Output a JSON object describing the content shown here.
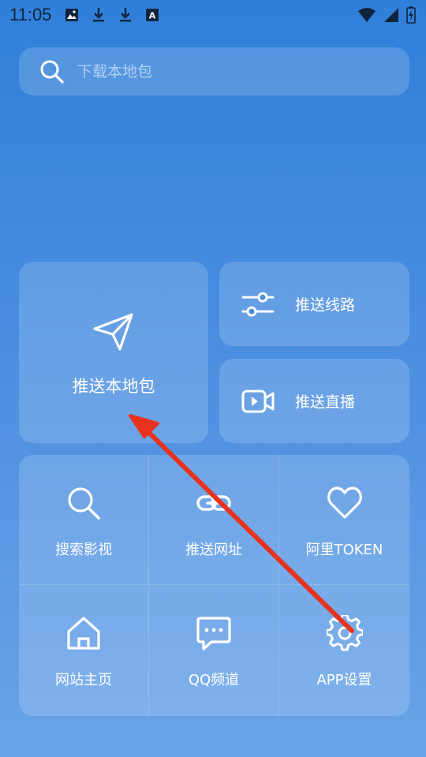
{
  "status_bar": {
    "time": "11:05",
    "left_icons": [
      "image-icon",
      "download-icon",
      "download-icon",
      "a-badge-icon"
    ],
    "right_icons": [
      "wifi-icon",
      "signal-icon",
      "battery-icon"
    ]
  },
  "search": {
    "placeholder": "下载本地包",
    "icon": "search-icon"
  },
  "main_card": {
    "label": "推送本地包",
    "icon": "send-icon"
  },
  "side_cards": [
    {
      "label": "推送线路",
      "icon": "sliders-icon"
    },
    {
      "label": "推送直播",
      "icon": "video-icon"
    }
  ],
  "grid": [
    {
      "label": "搜索影视",
      "icon": "search-icon"
    },
    {
      "label": "推送网址",
      "icon": "link-icon"
    },
    {
      "label": "阿里TOKEN",
      "icon": "heart-icon"
    },
    {
      "label": "网站主页",
      "icon": "home-icon"
    },
    {
      "label": "QQ频道",
      "icon": "chat-icon"
    },
    {
      "label": "APP设置",
      "icon": "gear-icon"
    }
  ],
  "annotation": {
    "arrow_color": "#e8321e"
  },
  "colors": {
    "background_top": "#2f7fd9",
    "background_bottom": "#6aa4e8",
    "text": "#ffffff"
  }
}
